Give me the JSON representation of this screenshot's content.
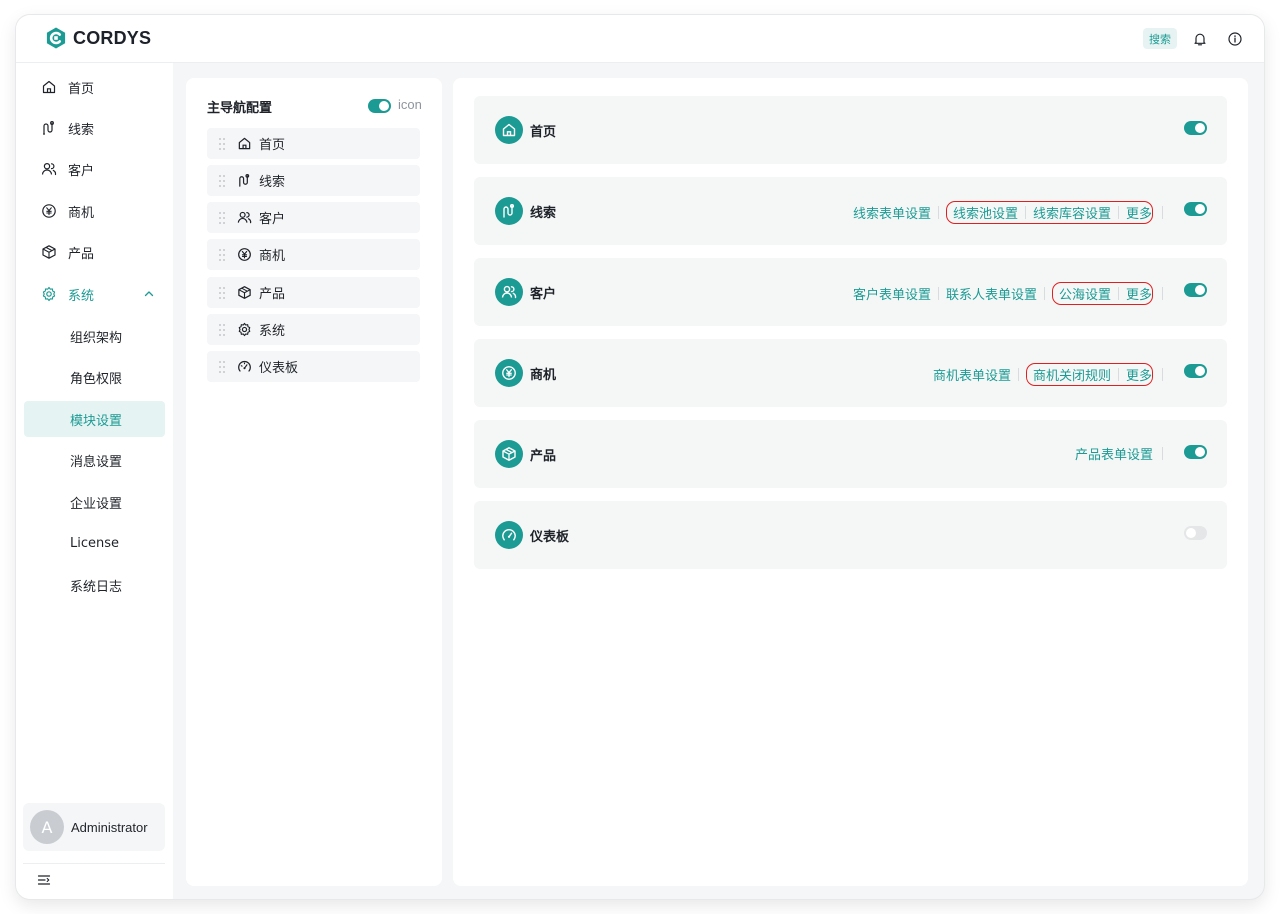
{
  "header": {
    "brand": "CORDYS",
    "search_label": "搜索"
  },
  "sidebar": {
    "items": [
      {
        "label": "首页",
        "icon": "home-icon"
      },
      {
        "label": "线索",
        "icon": "lead-icon"
      },
      {
        "label": "客户",
        "icon": "customer-icon"
      },
      {
        "label": "商机",
        "icon": "opportunity-icon"
      },
      {
        "label": "产品",
        "icon": "product-icon"
      },
      {
        "label": "系统",
        "icon": "gear-icon",
        "expanded": true
      }
    ],
    "sub_items": [
      {
        "label": "组织架构"
      },
      {
        "label": "角色权限"
      },
      {
        "label": "模块设置",
        "active": true
      },
      {
        "label": "消息设置"
      },
      {
        "label": "企业设置"
      },
      {
        "label": "License"
      },
      {
        "label": "系统日志"
      }
    ],
    "user": {
      "initial": "A",
      "name": "Administrator"
    }
  },
  "nav_config": {
    "title": "主导航配置",
    "icon_toggle_label": "icon",
    "icon_toggle_on": true,
    "items": [
      {
        "label": "首页",
        "icon": "home-icon"
      },
      {
        "label": "线索",
        "icon": "lead-icon"
      },
      {
        "label": "客户",
        "icon": "customer-icon"
      },
      {
        "label": "商机",
        "icon": "opportunity-icon"
      },
      {
        "label": "产品",
        "icon": "product-icon"
      },
      {
        "label": "系统",
        "icon": "gear-icon"
      },
      {
        "label": "仪表板",
        "icon": "dashboard-icon"
      }
    ]
  },
  "modules": [
    {
      "title": "首页",
      "icon": "home-icon",
      "enabled": true,
      "links": [],
      "highlighted": []
    },
    {
      "title": "线索",
      "icon": "lead-icon",
      "enabled": true,
      "links": [
        "线索表单设置"
      ],
      "highlighted": [
        "线索池设置",
        "线索库容设置",
        "更多"
      ]
    },
    {
      "title": "客户",
      "icon": "customer-icon",
      "enabled": true,
      "links": [
        "客户表单设置",
        "联系人表单设置"
      ],
      "highlighted": [
        "公海设置",
        "更多"
      ]
    },
    {
      "title": "商机",
      "icon": "opportunity-icon",
      "enabled": true,
      "links": [
        "商机表单设置"
      ],
      "highlighted": [
        "商机关闭规则",
        "更多"
      ]
    },
    {
      "title": "产品",
      "icon": "product-icon",
      "enabled": true,
      "links": [
        "产品表单设置"
      ],
      "highlighted": []
    },
    {
      "title": "仪表板",
      "icon": "dashboard-icon",
      "enabled": false,
      "links": [],
      "highlighted": []
    }
  ],
  "colors": {
    "accent": "#1c9b94",
    "highlight_border": "#e02020"
  }
}
